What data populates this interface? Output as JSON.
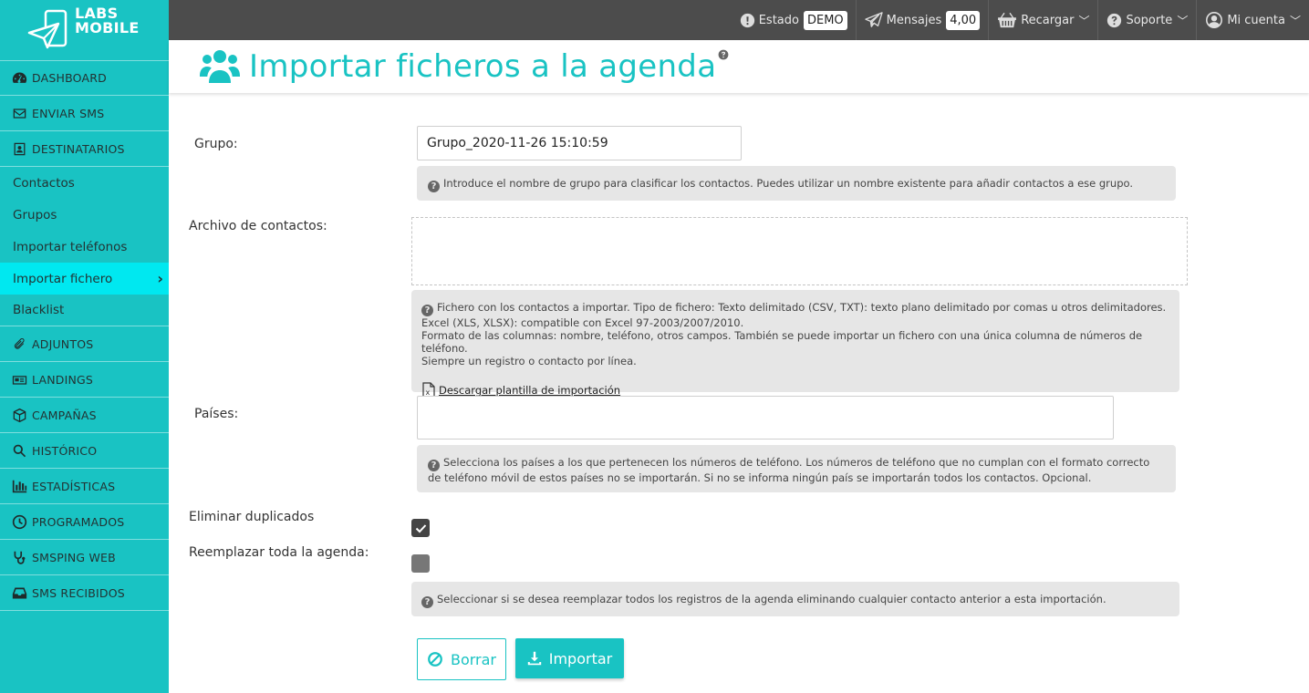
{
  "brand": {
    "line1": "LABS",
    "line2": "MOBILE"
  },
  "topbar": {
    "estado": {
      "label": "Estado",
      "badge": "DEMO"
    },
    "mensajes": {
      "label": "Mensajes",
      "badge": "4,00"
    },
    "recargar": {
      "label": "Recargar"
    },
    "soporte": {
      "label": "Soporte"
    },
    "cuenta": {
      "label": "Mi cuenta"
    }
  },
  "sidebar": {
    "items": [
      {
        "label": "DASHBOARD",
        "icon": "dashboard-icon"
      },
      {
        "label": "ENVIAR SMS",
        "icon": "envelope-icon"
      },
      {
        "label": "DESTINATARIOS",
        "icon": "contact-card-icon"
      }
    ],
    "sub": [
      {
        "label": "Contactos"
      },
      {
        "label": "Grupos"
      },
      {
        "label": "Importar teléfonos"
      },
      {
        "label": "Importar fichero",
        "active": true
      },
      {
        "label": "Blacklist"
      }
    ],
    "items2": [
      {
        "label": "ADJUNTOS",
        "icon": "paperclip-icon"
      },
      {
        "label": "LANDINGS",
        "icon": "newspaper-icon"
      },
      {
        "label": "CAMPAÑAS",
        "icon": "cube-icon"
      },
      {
        "label": "HISTÓRICO",
        "icon": "search-icon"
      },
      {
        "label": "ESTADÍSTICAS",
        "icon": "bar-chart-icon"
      },
      {
        "label": "PROGRAMADOS",
        "icon": "clock-icon"
      },
      {
        "label": "SMSPING WEB",
        "icon": "stethoscope-icon"
      },
      {
        "label": "SMS RECIBIDOS",
        "icon": "inbox-icon"
      }
    ]
  },
  "page": {
    "title": "Importar ficheros a la agenda"
  },
  "form": {
    "grupo": {
      "label": "Grupo:",
      "value": "Grupo_2020-11-26 15:10:59",
      "help": "Introduce el nombre de grupo para clasificar los contactos. Puedes utilizar un nombre existente para añadir contactos a ese grupo."
    },
    "archivo": {
      "label": "Archivo de contactos:",
      "help1": "Fichero con los contactos a importar. Tipo de fichero: Texto delimitado (CSV, TXT): texto plano delimitado por comas u otros delimitadores. Excel (XLS, XLSX): compatible con Excel 97-2003/2007/2010.",
      "help2": "Formato de las columnas: nombre, teléfono, otros campos. También se puede importar un fichero con una única columna de números de teléfono.",
      "help3": "Siempre un registro o contacto por línea.",
      "download": "Descargar plantilla de importación"
    },
    "paises": {
      "label": "Países:",
      "value": "",
      "help": "Selecciona los países a los que pertenecen los números de teléfono. Los números de teléfono que no cumplan con el formato correcto de teléfono móvil de estos países no se importarán. Si no se informa ningún país se importarán todos los contactos. Opcional."
    },
    "duplicados": {
      "label": "Eliminar duplicados",
      "checked": true
    },
    "reemplazar": {
      "label": "Reemplazar toda la agenda:",
      "checked": false,
      "help": "Seleccionar si se desea reemplazar todos los registros de la agenda eliminando cualquier contacto anterior a esta importación."
    },
    "buttons": {
      "borrar": "Borrar",
      "importar": "Importar"
    }
  },
  "colors": {
    "accent": "#19c3c3",
    "active": "#00e8f0",
    "topbar": "#4c4c4c"
  }
}
